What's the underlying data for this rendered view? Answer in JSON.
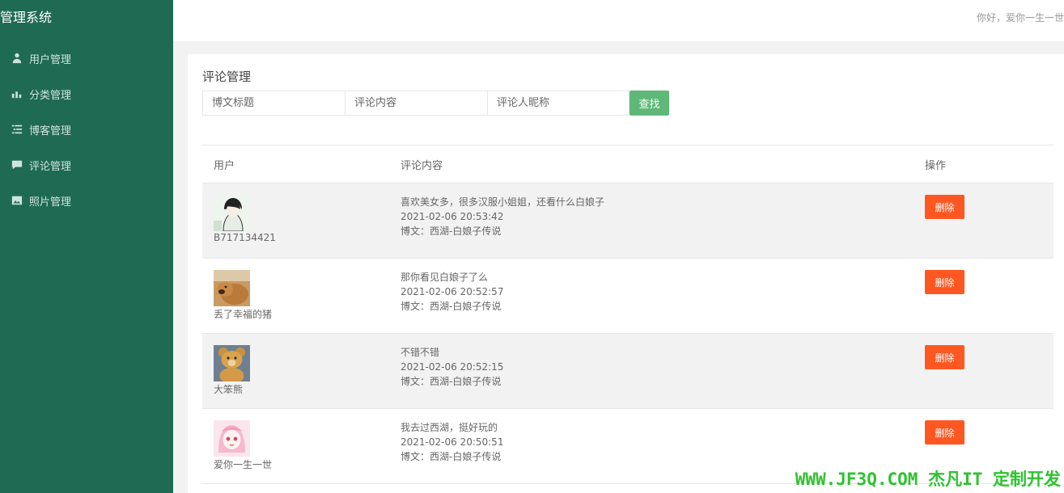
{
  "app": {
    "title": "管理系统"
  },
  "sidebar": {
    "items": [
      {
        "label": "用户管理",
        "icon": "user-icon"
      },
      {
        "label": "分类管理",
        "icon": "category-icon"
      },
      {
        "label": "博客管理",
        "icon": "blog-icon"
      },
      {
        "label": "评论管理",
        "icon": "comment-icon"
      },
      {
        "label": "照片管理",
        "icon": "photo-icon"
      }
    ]
  },
  "header": {
    "greeting": "你好，爱你一生一世"
  },
  "main": {
    "title": "评论管理",
    "search": {
      "blog_title_placeholder": "博文标题",
      "content_placeholder": "评论内容",
      "nickname_placeholder": "评论人昵称",
      "button_label": "查找"
    },
    "table": {
      "headers": {
        "user": "用户",
        "content": "评论内容",
        "op": "操作"
      },
      "rows": [
        {
          "nickname": "B717134421",
          "comment": "喜欢美女多，很多汉服小姐姐，还看什么白娘子",
          "time": "2021-02-06 20:53:42",
          "blog": "博文：西湖-白娘子传说",
          "delete_label": "删除",
          "avatar": "avatar-anime-boy-icon"
        },
        {
          "nickname": "丢了幸福的猪",
          "comment": "那你看见白娘子了么",
          "time": "2021-02-06 20:52:57",
          "blog": "博文：西湖-白娘子传说",
          "delete_label": "删除",
          "avatar": "avatar-dog-icon"
        },
        {
          "nickname": "大笨熊",
          "comment": "不错不错",
          "time": "2021-02-06 20:52:15",
          "blog": "博文：西湖-白娘子传说",
          "delete_label": "删除",
          "avatar": "avatar-bear-icon"
        },
        {
          "nickname": "爱你一生一世",
          "comment": "我去过西湖，挺好玩的",
          "time": "2021-02-06 20:50:51",
          "blog": "博文：西湖-白娘子传说",
          "delete_label": "删除",
          "avatar": "avatar-anime-girl-icon"
        }
      ]
    }
  },
  "watermark": {
    "text": "WWW.JF3Q.COM 杰凡IT  定制开发"
  },
  "colors": {
    "sidebar": "#1f6a53",
    "search_button": "#5fb878",
    "delete_button": "#ff5722",
    "watermark_footer": "#2ec22e"
  }
}
